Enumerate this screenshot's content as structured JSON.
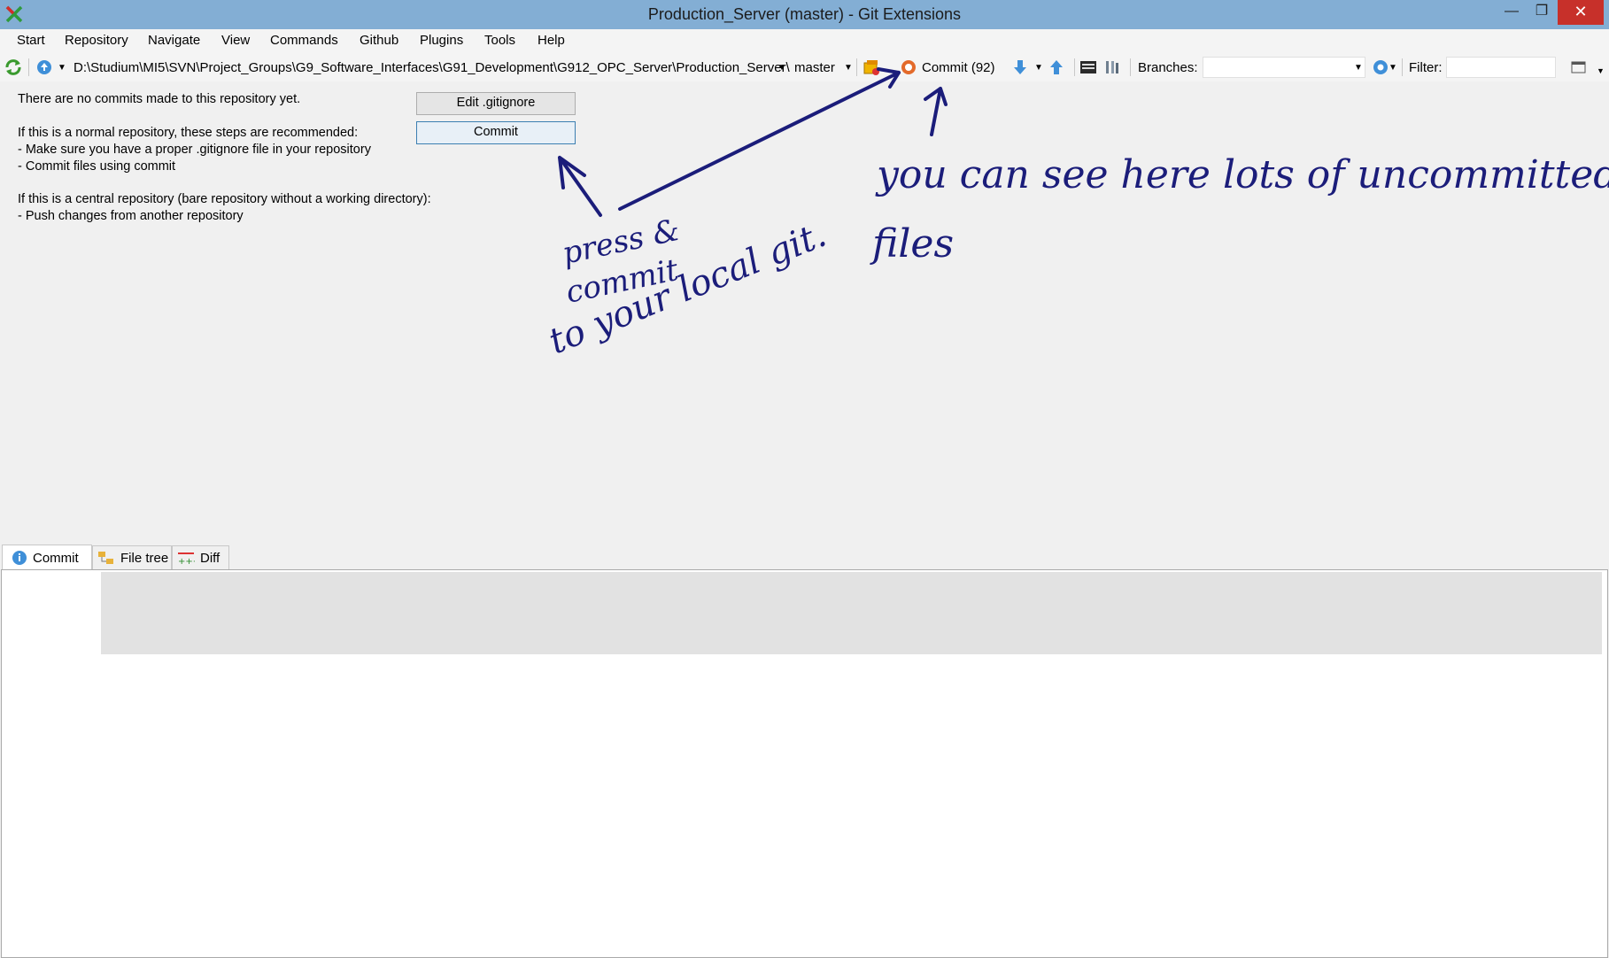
{
  "window": {
    "title": "Production_Server (master) - Git Extensions",
    "minimize": "—",
    "maximize": "❐",
    "close": "✕"
  },
  "menu": [
    "Start",
    "Repository",
    "Navigate",
    "View",
    "Commands",
    "Github",
    "Plugins",
    "Tools",
    "Help"
  ],
  "toolbar": {
    "path": "D:\\Studium\\MI5\\SVN\\Project_Groups\\G9_Software_Interfaces\\G91_Development\\G912_OPC_Server\\Production_Server\\",
    "branch": "master",
    "commit_label": "Commit (92)",
    "branches_label": "Branches:",
    "filter_label": "Filter:"
  },
  "main": {
    "line1": "There are no commits made to this repository yet.",
    "line2": "If this is a normal repository, these steps are recommended:",
    "line3": "- Make sure you have a proper .gitignore file in your repository",
    "line4": "- Commit files using commit",
    "line5": "If this is a central repository (bare repository without a working directory):",
    "line6": "- Push changes from another repository",
    "edit_gitignore_button": "Edit .gitignore",
    "commit_button": "Commit"
  },
  "tabs": [
    "Commit",
    "File tree",
    "Diff"
  ],
  "annotation": {
    "left_line1": "press &",
    "left_line2": "commit",
    "left_line3": "to your local git.",
    "right_line1": "you can see here lots of uncommitted",
    "right_line2": "files"
  },
  "colors": {
    "titlebar": "#83aed4",
    "ink": "#1b1d7a",
    "close_button": "#c7302a"
  }
}
